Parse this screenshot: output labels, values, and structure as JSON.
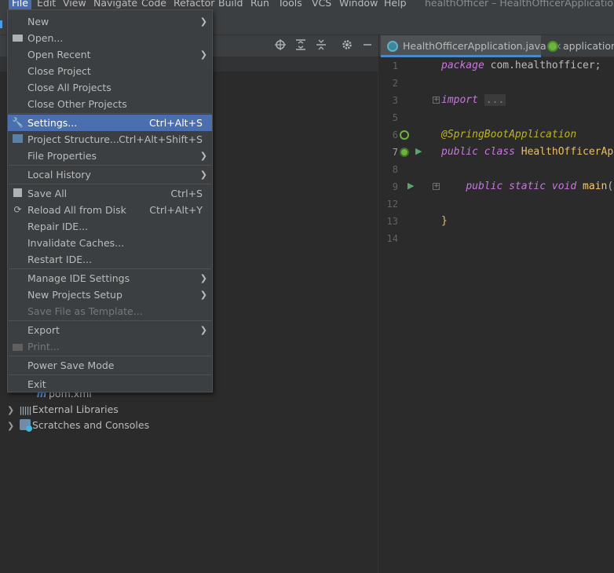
{
  "window_title": "healthOfficer – HealthOfficerApplication.java",
  "menubar": [
    {
      "label": "File",
      "active": true
    },
    {
      "label": "Edit"
    },
    {
      "label": "View"
    },
    {
      "label": "Navigate"
    },
    {
      "label": "Code"
    },
    {
      "label": "Refactor"
    },
    {
      "label": "Build"
    },
    {
      "label": "Run"
    },
    {
      "label": "Tools"
    },
    {
      "label": "VCS"
    },
    {
      "label": "Window"
    },
    {
      "label": "Help"
    }
  ],
  "file_menu": {
    "items": [
      {
        "label": "New",
        "submenu": true
      },
      {
        "label": "Open...",
        "icon": "folder-icon"
      },
      {
        "label": "Open Recent",
        "submenu": true
      },
      {
        "label": "Close Project"
      },
      {
        "label": "Close All Projects"
      },
      {
        "label": "Close Other Projects"
      },
      {
        "label": "Settings...",
        "shortcut": "Ctrl+Alt+S",
        "icon": "wrench-icon",
        "selected": true
      },
      {
        "label": "Project Structure...",
        "shortcut": "Ctrl+Alt+Shift+S",
        "icon": "project-structure-icon"
      },
      {
        "label": "File Properties",
        "submenu": true
      },
      {
        "label": "Local History",
        "submenu": true
      },
      {
        "label": "Save All",
        "shortcut": "Ctrl+S",
        "icon": "save-icon"
      },
      {
        "label": "Reload All from Disk",
        "shortcut": "Ctrl+Alt+Y",
        "icon": "reload-icon"
      },
      {
        "label": "Repair IDE..."
      },
      {
        "label": "Invalidate Caches..."
      },
      {
        "label": "Restart IDE..."
      },
      {
        "label": "Manage IDE Settings",
        "submenu": true
      },
      {
        "label": "New Projects Setup",
        "submenu": true
      },
      {
        "label": "Save File as Template...",
        "disabled": true
      },
      {
        "label": "Export",
        "submenu": true
      },
      {
        "label": "Print...",
        "icon": "print-icon",
        "disabled": true
      },
      {
        "label": "Power Save Mode"
      },
      {
        "label": "Exit"
      }
    ]
  },
  "project_tree": [
    {
      "label": "pom.xml",
      "icon": "maven-icon"
    },
    {
      "label": "External Libraries",
      "icon": "libraries-icon",
      "expandable": true
    },
    {
      "label": "Scratches and Consoles",
      "icon": "scratches-icon",
      "expandable": true
    }
  ],
  "editor": {
    "tabs": [
      {
        "label": "HealthOfficerApplication.java",
        "active": true,
        "close": "×"
      },
      {
        "label": "application.p"
      }
    ],
    "line_numbers": [
      "1",
      "2",
      "3",
      "5",
      "6",
      "7",
      "8",
      "9",
      "12",
      "13",
      "14"
    ],
    "code": {
      "l1_kw": "package",
      "l1_rest": " com.healthofficer;",
      "l3_kw": "import",
      "l3_fold": "...",
      "l6_ann": "@SpringBootApplication",
      "l7_kw1": "public",
      "l7_kw2": "class",
      "l7_cls": "HealthOfficerAp",
      "l9_kw1": "public",
      "l9_kw2": "static",
      "l9_kw3": "void",
      "l9_meth": "main",
      "l9_paren": "(",
      "l13_brace": "}"
    }
  },
  "colors": {
    "menu_bg": "#3c3f41",
    "menu_selected": "#4b6eaf",
    "editor_bg": "#2b2b2b",
    "annotation": "#bbb529",
    "keyword": "#c679dd",
    "run_gutter": "#59a869"
  }
}
